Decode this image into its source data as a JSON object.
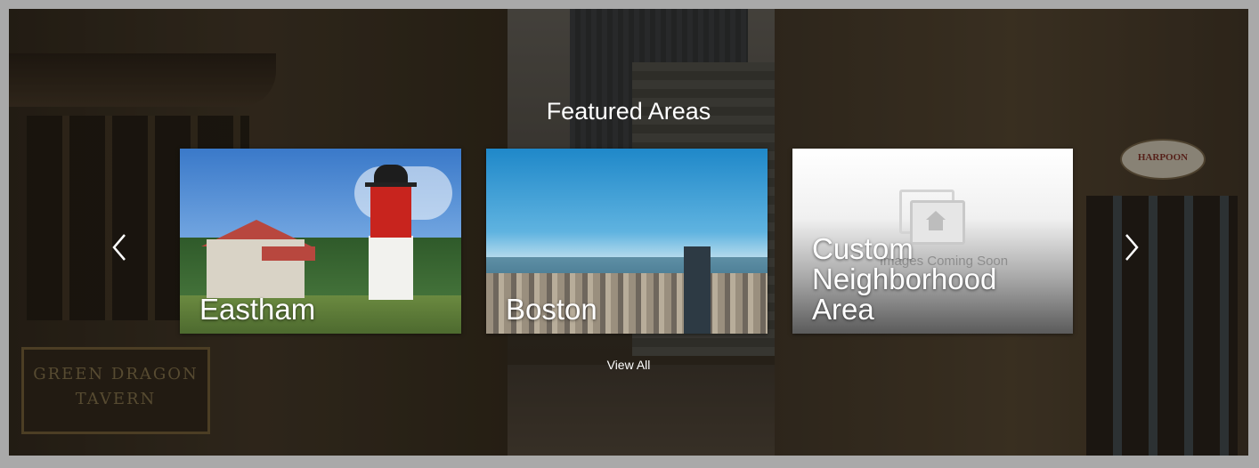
{
  "section": {
    "title": "Featured Areas",
    "view_all_label": "View All"
  },
  "background": {
    "tavern_sign": "GREEN DRAGON\nTAVERN",
    "store_sign": "HARPOON"
  },
  "cards": [
    {
      "label": "Eastham",
      "image": "lighthouse-photo"
    },
    {
      "label": "Boston",
      "image": "city-skyline-photo"
    },
    {
      "label": "Custom Neighborhood Area",
      "image": "images-coming-soon-placeholder",
      "placeholder_text": "Images Coming Soon"
    }
  ],
  "controls": {
    "prev_icon": "chevron-left-icon",
    "next_icon": "chevron-right-icon"
  }
}
